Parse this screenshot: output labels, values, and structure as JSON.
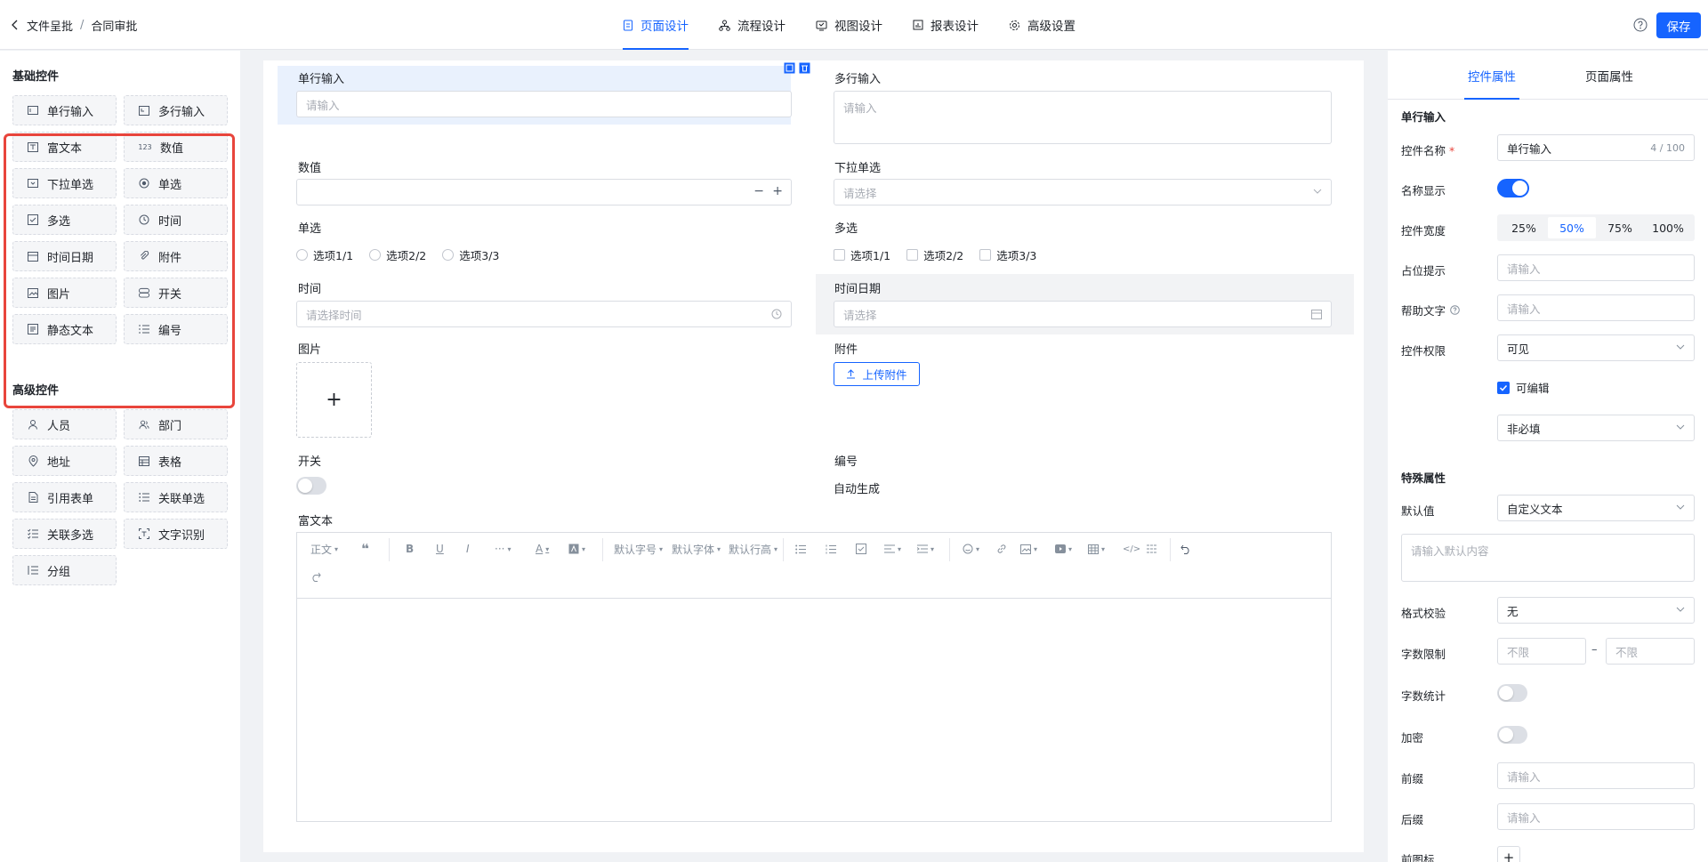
{
  "header": {
    "back_label": "文件呈批",
    "separator": "/",
    "current": "合同审批",
    "tabs": [
      {
        "label": "页面设计",
        "icon": "page-icon"
      },
      {
        "label": "流程设计",
        "icon": "flow-icon"
      },
      {
        "label": "视图设计",
        "icon": "view-icon"
      },
      {
        "label": "报表设计",
        "icon": "report-icon"
      },
      {
        "label": "高级设置",
        "icon": "gear-icon"
      }
    ],
    "active_tab": 0,
    "save_label": "保存"
  },
  "left": {
    "basic_title": "基础控件",
    "basic": [
      "单行输入",
      "多行输入",
      "富文本",
      "数值",
      "下拉单选",
      "单选",
      "多选",
      "时间",
      "时间日期",
      "附件",
      "图片",
      "开关",
      "静态文本",
      "编号"
    ],
    "advanced_title": "高级控件",
    "advanced": [
      "人员",
      "部门",
      "地址",
      "表格",
      "引用表单",
      "关联单选",
      "关联多选",
      "文字识别",
      "分组"
    ]
  },
  "canvas": {
    "single_label": "单行输入",
    "single_ph": "请输入",
    "multi_label": "多行输入",
    "multi_ph": "请输入",
    "number_label": "数值",
    "number_minus": "−",
    "number_plus": "+",
    "dropdown_label": "下拉单选",
    "dropdown_ph": "请选择",
    "radio_label": "单选",
    "radio_opts": [
      "选项1/1",
      "选项2/2",
      "选项3/3"
    ],
    "check_label": "多选",
    "check_opts": [
      "选项1/1",
      "选项2/2",
      "选项3/3"
    ],
    "time_label": "时间",
    "time_ph": "请选择时间",
    "datetime_label": "时间日期",
    "datetime_ph": "请选择",
    "image_label": "图片",
    "image_plus": "+",
    "attach_label": "附件",
    "upload_label": "上传附件",
    "switch_label": "开关",
    "serial_label": "编号",
    "serial_value": "自动生成",
    "rich_label": "富文本",
    "toolbar": {
      "para": "正文",
      "font_size": "默认字号",
      "font_family": "默认字体",
      "line_height": "默认行高",
      "more": "···"
    }
  },
  "right": {
    "tabs": [
      "控件属性",
      "页面属性"
    ],
    "active_tab": 0,
    "section_title": "单行输入",
    "name_label": "控件名称",
    "name_value": "单行输入",
    "name_count": "4 / 100",
    "show_name_label": "名称显示",
    "show_name_on": true,
    "width_label": "控件宽度",
    "width_options": [
      "25%",
      "50%",
      "75%",
      "100%"
    ],
    "width_selected": 1,
    "placeholder_label": "占位提示",
    "placeholder_ph": "请输入",
    "help_label": "帮助文字",
    "help_ph": "请输入",
    "perm_label": "控件权限",
    "perm_value": "可见",
    "editable_label": "可编辑",
    "editable_checked": true,
    "required_value": "非必填",
    "special_title": "特殊属性",
    "default_label": "默认值",
    "default_value": "自定义文本",
    "default_ph": "请输入默认内容",
    "format_label": "格式校验",
    "format_value": "无",
    "limit_label": "字数限制",
    "limit_min_ph": "不限",
    "limit_dash": "–",
    "limit_max_ph": "不限",
    "count_label": "字数统计",
    "encrypt_label": "加密",
    "prefix_label": "前缀",
    "prefix_ph": "请输入",
    "suffix_label": "后缀",
    "suffix_ph": "请输入",
    "prefix_icon_label": "前图标",
    "prefix_icon_add": "+"
  },
  "colors": {
    "accent": "#1664ff",
    "highlight": "#e8453c",
    "selected_bg": "#e9f1fd"
  }
}
